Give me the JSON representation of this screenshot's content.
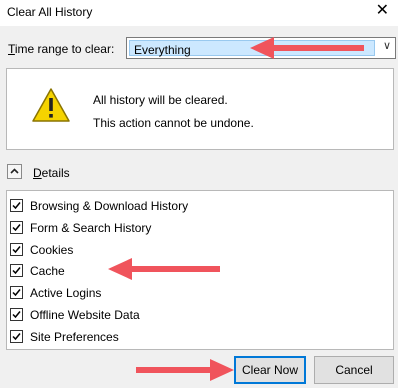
{
  "window": {
    "title": "Clear All History",
    "close_glyph": "✕"
  },
  "time_range": {
    "label": "Time range to clear:",
    "value": "Everything"
  },
  "warning": {
    "icon": "warning-icon",
    "line1": "All history will be cleared.",
    "line2": "This action cannot be undone."
  },
  "details": {
    "label": "Details",
    "expanded": true
  },
  "items": [
    {
      "label": "Browsing & Download History",
      "checked": true
    },
    {
      "label": "Form & Search History",
      "checked": true
    },
    {
      "label": "Cookies",
      "checked": true
    },
    {
      "label": "Cache",
      "checked": true
    },
    {
      "label": "Active Logins",
      "checked": true
    },
    {
      "label": "Offline Website Data",
      "checked": true
    },
    {
      "label": "Site Preferences",
      "checked": true
    }
  ],
  "buttons": {
    "clear": "Clear Now",
    "cancel": "Cancel"
  },
  "colors": {
    "annotation_arrow": "#f0545c",
    "focus": "#0078d7",
    "selection": "#cce8ff"
  }
}
